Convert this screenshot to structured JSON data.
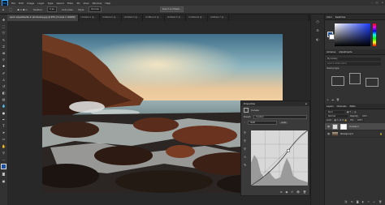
{
  "menubar": {
    "app_badge": "Ps",
    "items": [
      "File",
      "Edit",
      "Image",
      "Layer",
      "Type",
      "Select",
      "Filter",
      "3D",
      "View",
      "Window",
      "Help"
    ]
  },
  "options": {
    "feather": "Feather",
    "feather_value": "0 px",
    "anti_alias": "Anti-alias",
    "style_label": "Style",
    "style_value": "Normal",
    "select_mask": "Select and Mask..."
  },
  "tabs": [
    {
      "label": "quick adjustments in photoshop.jpg @ 95% (Curves 1, RGB/8)",
      "active": true
    },
    {
      "label": "Untitled-1 @ ...",
      "active": false
    },
    {
      "label": "Untitled-2 @ ...",
      "active": false
    },
    {
      "label": "Untitled-3 @ ...",
      "active": false
    },
    {
      "label": "Untitled-4 @ ...",
      "active": false
    },
    {
      "label": "Untitled-5 @ ...",
      "active": false
    },
    {
      "label": "Untitled-6 @ ...",
      "active": false
    },
    {
      "label": "Untitled-7 @ ...",
      "active": false
    }
  ],
  "color_panel": {
    "tabs": [
      "Color",
      "Swatches"
    ]
  },
  "libraries": {
    "tabs": [
      "Libraries",
      "Adjustments"
    ],
    "search_placeholder": "Search Adobe Stock",
    "library_name": "My Library",
    "view_by": "View by type"
  },
  "properties": {
    "title": "Properties",
    "subtitle": "Curves",
    "preset_label": "Preset:",
    "preset_value": "Custom",
    "channel_value": "RGB",
    "auto_label": "Auto"
  },
  "layers": {
    "tabs": [
      "Layers",
      "Channels",
      "Paths"
    ],
    "kind": "Kind",
    "blend": "Normal",
    "opacity_label": "Opacity:",
    "opacity": "100%",
    "lock_label": "Lock:",
    "fill_label": "Fill:",
    "fill": "100%",
    "items": [
      {
        "name": "Curves 1"
      },
      {
        "name": "Background"
      }
    ]
  },
  "colors": {
    "accent": "#31a8ff",
    "panel": "#323232",
    "bg": "#1e1e1e"
  }
}
